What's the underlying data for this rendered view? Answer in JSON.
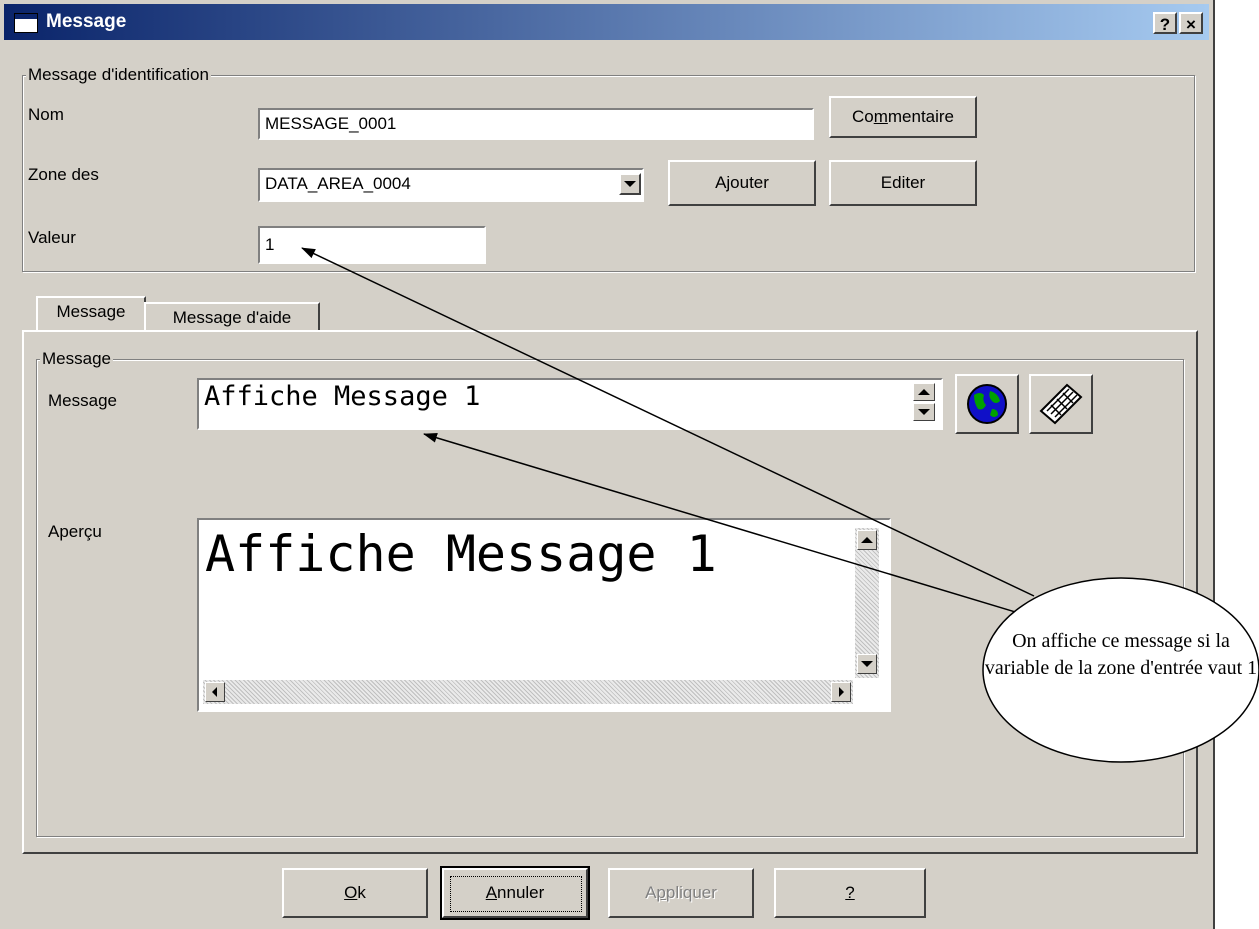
{
  "window": {
    "title": "Message",
    "help_glyph": "?",
    "close_glyph": "×"
  },
  "identification": {
    "group_label": "Message d'identification",
    "nom_label": "Nom",
    "nom_value": "MESSAGE_0001",
    "commentaire_pre": "Co",
    "commentaire_u": "m",
    "commentaire_post": "mentaire",
    "zone_label": "Zone des",
    "zone_value": "DATA_AREA_0004",
    "ajouter_label": "Ajouter",
    "editer_label": "Editer",
    "valeur_label": "Valeur",
    "valeur_value": "1"
  },
  "tabs": {
    "tab_message": "Message",
    "tab_aide": "Message d'aide"
  },
  "message_group": {
    "group_label": "Message",
    "message_label": "Message",
    "message_value": "Affiche Message 1",
    "apercu_label": "Aperçu",
    "apercu_value": "Affiche Message 1",
    "globe_icon": "globe-icon",
    "keyboard_icon": "keyboard-icon"
  },
  "annotation": {
    "text": "On affiche ce message si la variable de la zone d'entrée vaut 1"
  },
  "buttons": {
    "ok_u": "O",
    "ok_post": "k",
    "annuler_u": "A",
    "annuler_post": "nnuler",
    "appliquer_pre": "A",
    "appliquer_u": "p",
    "appliquer_post": "pliquer",
    "help_u": "?"
  },
  "colors": {
    "titlebar_start": "#0a246a",
    "titlebar_end": "#a6caf0",
    "face": "#d4d0c8"
  }
}
